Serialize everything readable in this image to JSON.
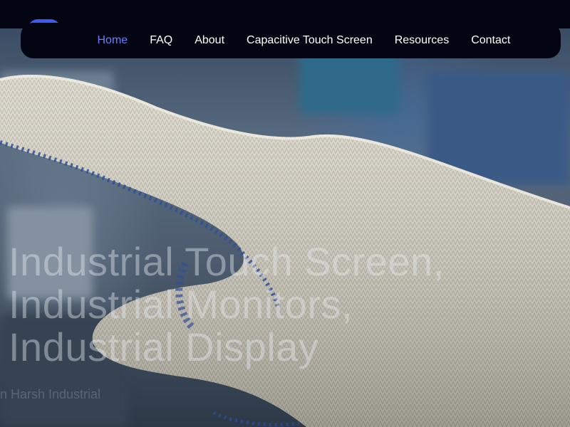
{
  "nav": {
    "items": [
      {
        "label": "Home",
        "active": true
      },
      {
        "label": "FAQ",
        "active": false
      },
      {
        "label": "About",
        "active": false
      },
      {
        "label": "Capacitive Touch Screen",
        "active": false
      },
      {
        "label": "Resources",
        "active": false
      },
      {
        "label": "Contact",
        "active": false
      }
    ]
  },
  "hero": {
    "headline": [
      "Industrial Touch Screen,",
      "Industrial Monitors,",
      "Industrial Display"
    ],
    "subline": "in Harsh Industrial"
  },
  "colors": {
    "nav_background": "#030612",
    "nav_active": "#6b7cff",
    "accent": "#3d5af1"
  }
}
